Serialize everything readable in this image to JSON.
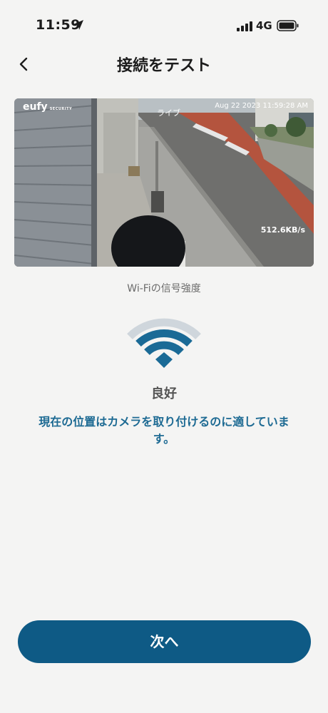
{
  "status_bar": {
    "time": "11:59",
    "network": "4G"
  },
  "header": {
    "title": "接続をテスト"
  },
  "preview": {
    "brand": "eufy",
    "brand_sub": "SECURITY",
    "timestamp": "Aug 22 2023 11:59:28 AM",
    "live_label": "ライブ",
    "bitrate": "512.6KB/s"
  },
  "signal": {
    "label": "Wi-Fiの信号強度",
    "quality": "良好",
    "message": "現在の位置はカメラを取り付けるのに適しています。",
    "level": "3/4",
    "active_color": "#1a6a96",
    "inactive_color": "#cfd6dc"
  },
  "footer": {
    "next_label": "次へ"
  }
}
